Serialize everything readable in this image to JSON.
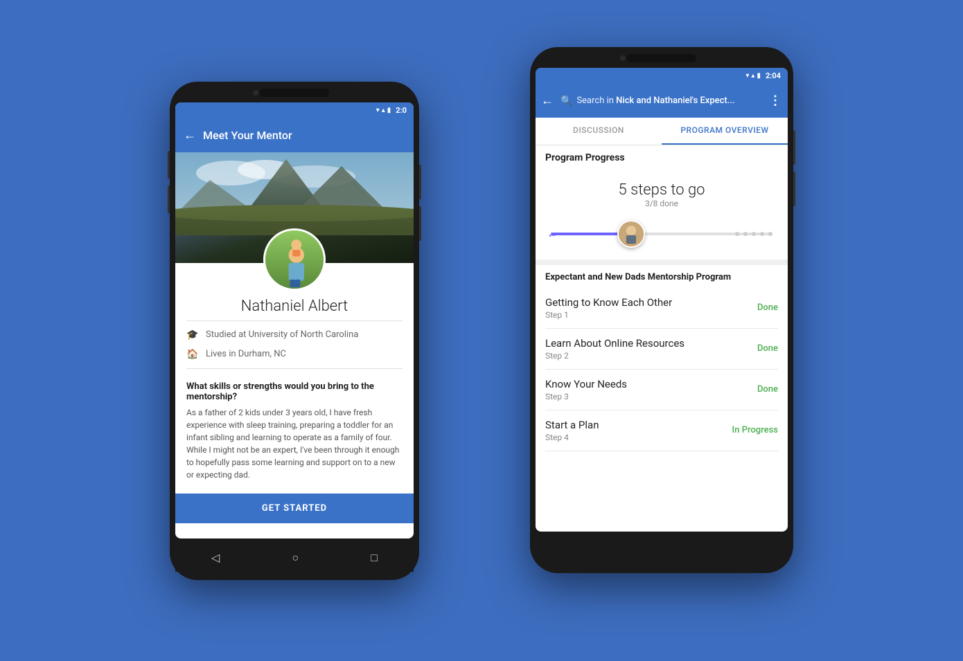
{
  "background": "#3d6dbf",
  "phone_left": {
    "status_bar": {
      "time": "2:0",
      "wifi": "▼",
      "signal": "▲",
      "battery": "▮"
    },
    "app_bar": {
      "back_label": "←",
      "title": "Meet Your Mentor"
    },
    "profile": {
      "name": "Nathaniel Albert",
      "education": "Studied at University of North Carolina",
      "location": "Lives in Durham, NC",
      "question_title": "What skills or strengths would you bring to the mentorship?",
      "question_answer": "As a father of 2 kids under 3 years old, I have fresh experience with sleep training, preparing a toddler for an infant sibling and learning to operate as a family of four. While I might not be an expert, I've been through it enough to hopefully pass some learning and support on to a new or expecting dad."
    },
    "cta_button": "GET STARTED",
    "nav": {
      "back": "◁",
      "home": "○",
      "recents": "□"
    }
  },
  "phone_right": {
    "status_bar": {
      "time": "2:04",
      "wifi": "▼",
      "signal": "▲",
      "battery": "▮"
    },
    "app_bar": {
      "back_label": "←",
      "search_placeholder": "Search in",
      "search_context": "Nick and Nathaniel's Expect...",
      "more_icon": "⋮"
    },
    "tabs": [
      {
        "label": "DISCUSSION",
        "active": false
      },
      {
        "label": "PROGRAM OVERVIEW",
        "active": true
      }
    ],
    "program_section": {
      "title": "Program Progress",
      "steps_to_go": "5 steps to go",
      "done_fraction": "3/8 done",
      "progress_percent": 37.5
    },
    "steps_section": {
      "label": "Expectant and New Dads Mentorship Program",
      "steps": [
        {
          "name": "Getting to Know Each Other",
          "number": "Step 1",
          "status": "Done",
          "status_type": "done"
        },
        {
          "name": "Learn About Online Resources",
          "number": "Step 2",
          "status": "Done",
          "status_type": "done"
        },
        {
          "name": "Know Your Needs",
          "number": "Step 3",
          "status": "Done",
          "status_type": "done"
        },
        {
          "name": "Start a Plan",
          "number": "Step 4",
          "status": "In Progress",
          "status_type": "progress"
        }
      ]
    }
  }
}
